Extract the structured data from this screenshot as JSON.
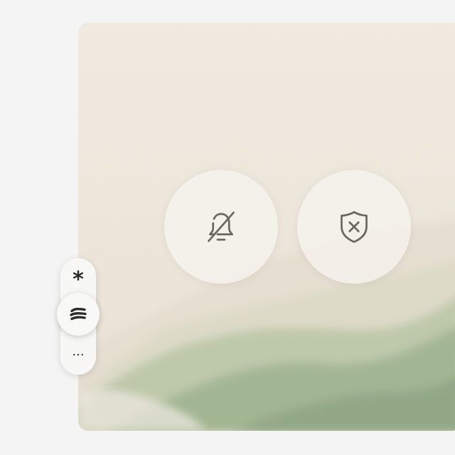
{
  "toolbar": {
    "items": [
      {
        "id": "asterisk",
        "glyph": "*",
        "icon": "asterisk-icon",
        "active": false
      },
      {
        "id": "style",
        "icon": "wavy-lines-icon",
        "active": true
      },
      {
        "id": "more",
        "glyph": "···",
        "icon": "more-dots-icon",
        "active": false
      }
    ]
  },
  "actions": {
    "mute": {
      "icon": "bell-slash-icon"
    },
    "block": {
      "icon": "shield-x-icon"
    }
  },
  "colors": {
    "page_background": "#f4f4f4",
    "paper": "#eee6db",
    "hill_light": "#c9d2b7",
    "hill_mid": "#a9bb96",
    "hill_dark": "#93a987",
    "icon_stroke": "#6b6864",
    "glyph": "#2b2b2b"
  }
}
